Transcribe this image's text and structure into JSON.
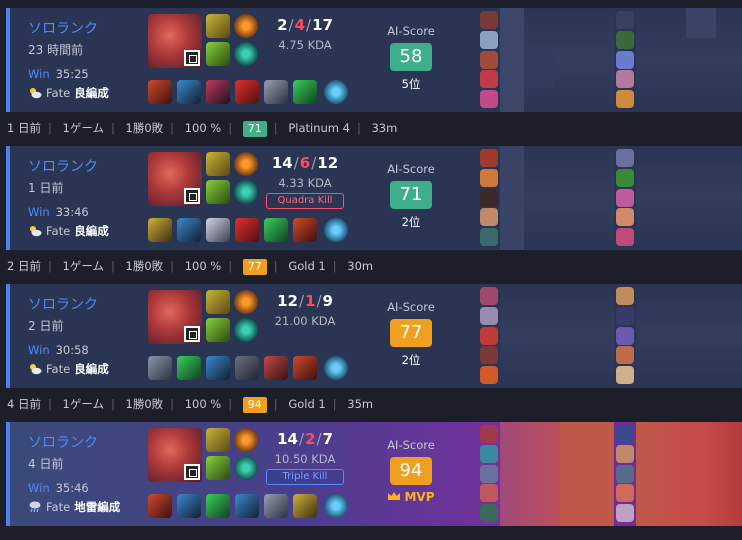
{
  "matches": [
    {
      "type": "ソロランク",
      "time": "23 時間前",
      "result": "Win",
      "duration": "35:25",
      "fate_label": "Fate",
      "fate": "良編成",
      "kills": "2",
      "deaths": "4",
      "assists": "17",
      "kda": "4.75 KDA",
      "badge": "",
      "ai_label": "AI-Score",
      "score": "58",
      "score_color": "#3fae8a",
      "rank": "5位",
      "mvp": false
    },
    {
      "type": "ソロランク",
      "time": "1 日前",
      "result": "Win",
      "duration": "33:46",
      "fate_label": "Fate",
      "fate": "良編成",
      "kills": "14",
      "deaths": "6",
      "assists": "12",
      "kda": "4.33 KDA",
      "badge": "Quadra Kill",
      "ai_label": "AI-Score",
      "score": "71",
      "score_color": "#3fae8a",
      "rank": "2位",
      "mvp": false
    },
    {
      "type": "ソロランク",
      "time": "2 日前",
      "result": "Win",
      "duration": "30:58",
      "fate_label": "Fate",
      "fate": "良編成",
      "kills": "12",
      "deaths": "1",
      "assists": "9",
      "kda": "21.00 KDA",
      "badge": "",
      "ai_label": "AI-Score",
      "score": "77",
      "score_color": "#f0a020",
      "rank": "2位",
      "mvp": false
    },
    {
      "type": "ソロランク",
      "time": "4 日前",
      "result": "Win",
      "duration": "35:46",
      "fate_label": "Fate",
      "fate": "地雷編成",
      "kills": "14",
      "deaths": "2",
      "assists": "7",
      "kda": "10.50 KDA",
      "badge": "Triple Kill",
      "ai_label": "AI-Score",
      "score": "94",
      "score_color": "#f0a020",
      "rank": "MVP",
      "mvp": true
    }
  ],
  "day_summaries": [
    {
      "day": "1 日前",
      "games": "1ゲーム",
      "record": "1勝0敗",
      "winrate": "100 %",
      "score": "71",
      "score_color": "#3fae8a",
      "rank": "Platinum 4",
      "time": "33m"
    },
    {
      "day": "2 日前",
      "games": "1ゲーム",
      "record": "1勝0敗",
      "winrate": "100 %",
      "score": "77",
      "score_color": "#f0a020",
      "rank": "Gold 1",
      "time": "30m"
    },
    {
      "day": "4 日前",
      "games": "1ゲーム",
      "record": "1勝0敗",
      "winrate": "100 %",
      "score": "94",
      "score_color": "#f0a020",
      "rank": "Gold 1",
      "time": "35m"
    }
  ]
}
